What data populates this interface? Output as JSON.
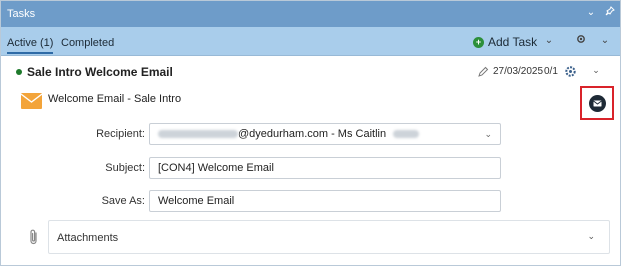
{
  "window": {
    "title": "Tasks",
    "controls": [
      "chevron-down-icon",
      "pin-icon"
    ]
  },
  "tabs": [
    {
      "label": "Active (1)",
      "active": true
    },
    {
      "label": "Completed",
      "active": false
    }
  ],
  "toolbar": {
    "add_task_label": "Add Task"
  },
  "task": {
    "title": "Sale Intro Welcome Email",
    "status_color": "#1e7a2c",
    "date": "27/03/2025",
    "progress": "0/1",
    "subtitle": "Welcome Email - Sale Intro"
  },
  "form": {
    "recipient_label": "Recipient:",
    "recipient_visible": "@dyedurham.com - Ms Caitlin",
    "subject_label": "Subject:",
    "subject_value": "[CON4] Welcome Email",
    "save_as_label": "Save As:",
    "save_as_value": "Welcome Email"
  },
  "attachments": {
    "label": "Attachments"
  },
  "colors": {
    "titlebar": "#6e9cc9",
    "tabbar": "#a9cdeb",
    "highlight_box": "#d9232a",
    "envelope": "#f3a43a"
  }
}
